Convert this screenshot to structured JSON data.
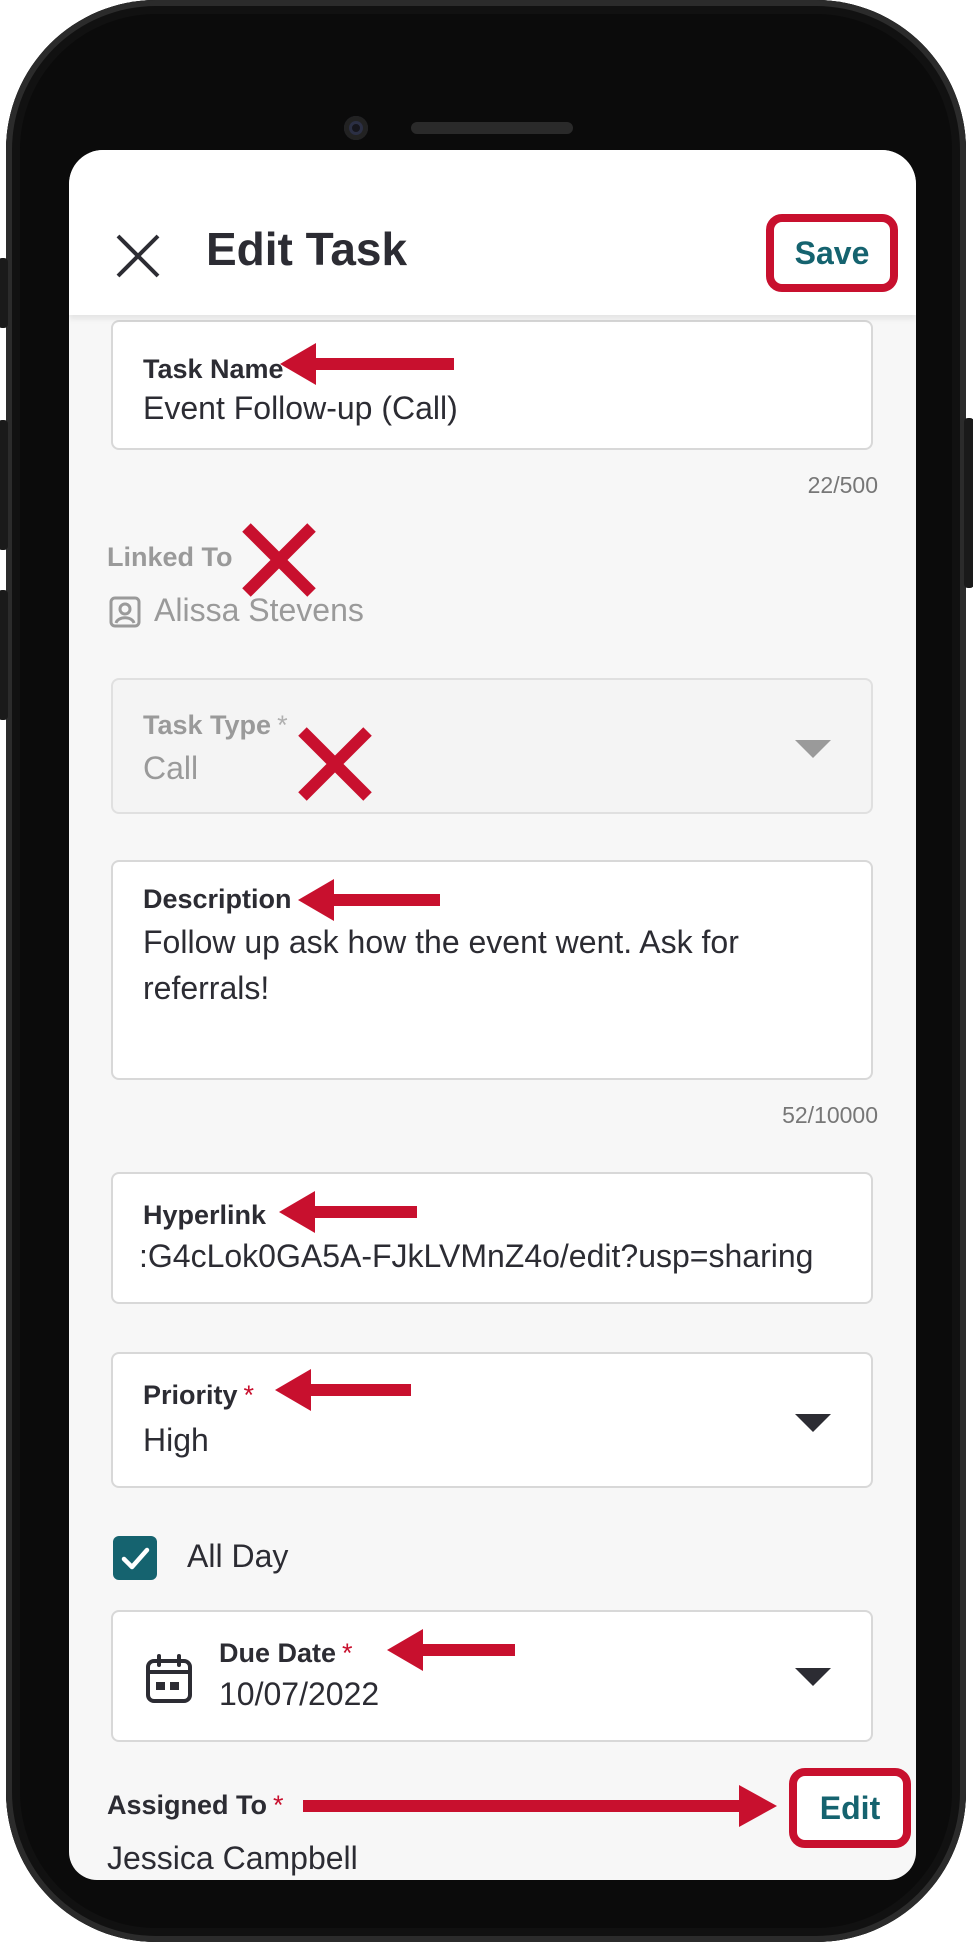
{
  "header": {
    "title": "Edit Task",
    "save_label": "Save",
    "close_icon": "close-icon"
  },
  "task_name": {
    "label": "Task Name",
    "required": "*",
    "value": "Event Follow-up (Call)",
    "counter": "22/500"
  },
  "linked_to": {
    "label": "Linked To",
    "value": "Alissa Stevens",
    "icon": "contact-icon"
  },
  "task_type": {
    "label": "Task Type",
    "required": "*",
    "value": "Call"
  },
  "description": {
    "label": "Description",
    "line1": "Follow up ask how the event went. Ask for",
    "line2": "referrals!",
    "counter": "52/10000"
  },
  "hyperlink": {
    "label": "Hyperlink",
    "value": ":G4cLok0GA5A-FJkLVMnZ4o/edit?usp=sharing"
  },
  "priority": {
    "label": "Priority",
    "required": "*",
    "value": "High"
  },
  "all_day": {
    "label": "All Day",
    "checked": true
  },
  "due_date": {
    "label": "Due Date",
    "required": "*",
    "value": "10/07/2022",
    "icon": "calendar-icon"
  },
  "assigned_to": {
    "label": "Assigned To",
    "required": "*",
    "value": "Jessica Campbell",
    "edit_label": "Edit"
  },
  "colors": {
    "accent": "#15636f",
    "annotation": "#c8102e",
    "text": "#2c2c33"
  }
}
